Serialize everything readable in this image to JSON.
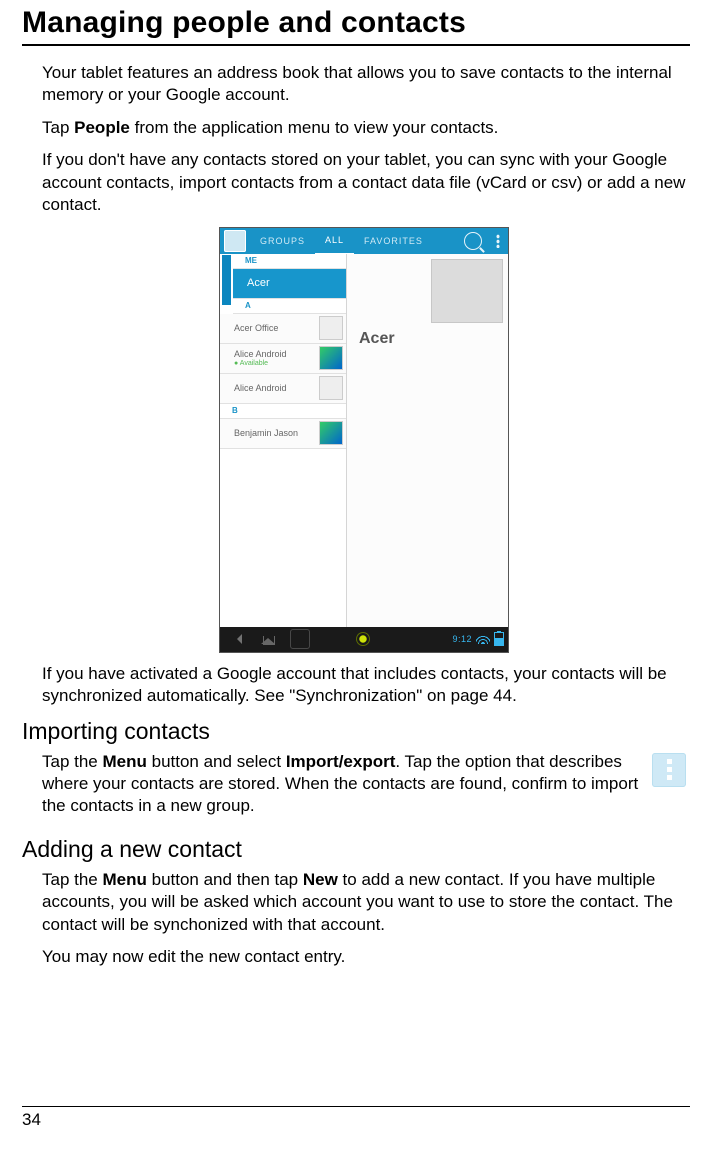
{
  "title": "Managing people and contacts",
  "intro1": "Your tablet features an address book that allows you to save contacts to the internal memory or your Google account.",
  "intro2_pre": "Tap ",
  "intro2_bold": "People",
  "intro2_post": " from the application menu to view your contacts.",
  "intro3": "If you don't have any contacts stored on your tablet, you can sync with your Google account contacts, import contacts from a contact data file (vCard or csv) or add a new contact.",
  "after_shot": "If you have activated a Google account that includes contacts, your contacts will be synchronized automatically. See \"Synchronization\" on page 44.",
  "section_import_title": "Importing contacts",
  "import_p_1": "Tap the ",
  "import_p_b1": "Menu",
  "import_p_2": " button and select ",
  "import_p_b2": "Import/export",
  "import_p_3": ". Tap the option that describes where your contacts are stored. When the contacts are found, confirm to import the contacts in a new group.",
  "section_add_title": "Adding a new contact",
  "add_p1_1": "Tap the ",
  "add_p1_b1": "Menu",
  "add_p1_2": " button and then tap ",
  "add_p1_b2": "New",
  "add_p1_3": " to add a new contact. If you have multiple accounts, you will be asked which account you want to use to store the contact. The contact will be synchonized with that account.",
  "add_p2": "You may now edit the new contact entry.",
  "page_number": "34",
  "shot": {
    "tabs": {
      "groups": "GROUPS",
      "all": "ALL",
      "fav": "FAVORITES"
    },
    "hdr_me": "ME",
    "row_acer": "Acer",
    "hdr_a": "A",
    "row_office": "Acer Office",
    "row_alice": "Alice Android",
    "row_alice_sub": "Available",
    "row_alice2": "Alice Android",
    "hdr_b": "B",
    "row_ben": "Benjamin Jason",
    "detail_name": "Acer",
    "clock": "9:12"
  }
}
